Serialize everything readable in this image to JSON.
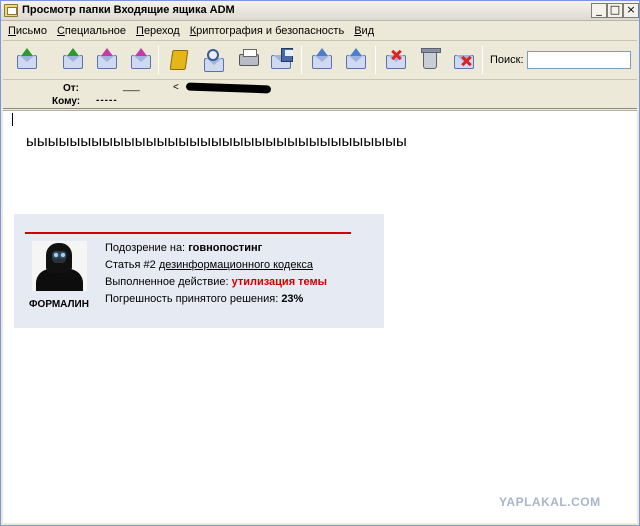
{
  "window": {
    "title": "Просмотр папки Входящие ящика ADM",
    "minimize": "_",
    "maximize": "□",
    "close": "×"
  },
  "menu": [
    {
      "u": "П",
      "rest": "исьмо"
    },
    {
      "u": "С",
      "rest": "пециальное"
    },
    {
      "u": "П",
      "rest": "ереход"
    },
    {
      "u": "К",
      "rest": "риптография и безопасность"
    },
    {
      "u": "В",
      "rest": "ид"
    }
  ],
  "toolbar": {
    "icons": [
      "mail-receive-icon",
      "mail-send-receive-icon",
      "mail-forward-icon",
      "mail-new-icon",
      "address-book-icon",
      "mail-search-icon",
      "printer-icon",
      "save-disk-icon",
      "mail-prev-icon",
      "mail-next-icon",
      "mail-delete-icon",
      "trash-icon",
      "mail-junk-icon"
    ],
    "search_label": "Поиск:",
    "search_value": ""
  },
  "header": {
    "from_label": "От:",
    "from_value": "___",
    "from_email_prefix": "<",
    "to_label": "Кому:",
    "to_value": "-----"
  },
  "message": {
    "body_text": "ыыыыыыыыыыыыыыыыыыыыыыыыыыыыыыыыыыы"
  },
  "signature": {
    "avatar_caption": "ФОРМАЛИН",
    "suspicion_label": "Подозрение на:",
    "suspicion_value": "говнопостинг",
    "article_label": "Статья #2",
    "article_link": "дезинформационного кодекса",
    "action_label": "Выполненное действие:",
    "action_value": "утилизация темы",
    "error_label": "Погрешность принятого решения:",
    "error_value": "23%",
    "accent_color": "#d10000"
  },
  "watermark": "YAPLAKAL.COM"
}
